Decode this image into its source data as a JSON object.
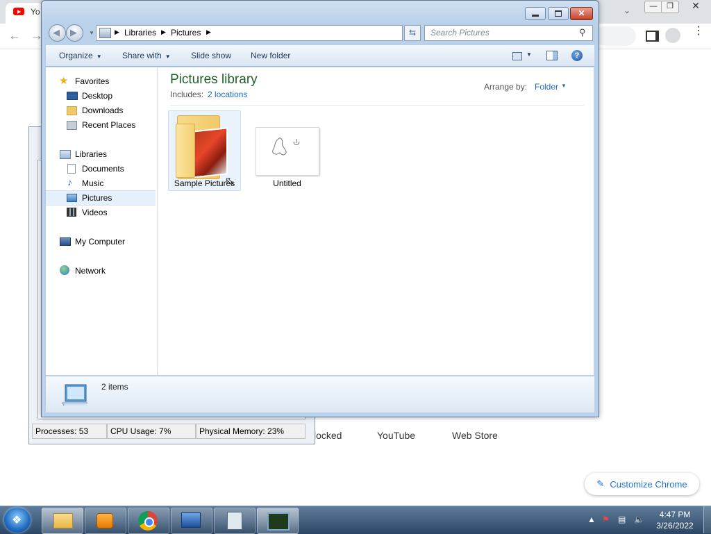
{
  "chrome": {
    "tab_title": "Yo",
    "shortcuts": [
      "locked",
      "YouTube",
      "Web Store"
    ],
    "customize_label": "Customize Chrome"
  },
  "task_manager": {
    "processes": "Processes: 53",
    "cpu": "CPU Usage: 7%",
    "memory": "Physical Memory: 23%"
  },
  "explorer": {
    "address": {
      "crumbs": [
        "Libraries",
        "Pictures"
      ]
    },
    "search": {
      "placeholder": "Search Pictures"
    },
    "commands": {
      "organize": "Organize",
      "share_with": "Share with",
      "slide_show": "Slide show",
      "new_folder": "New folder"
    },
    "nav": {
      "favorites": "Favorites",
      "desktop": "Desktop",
      "downloads": "Downloads",
      "recent_places": "Recent Places",
      "libraries": "Libraries",
      "documents": "Documents",
      "music": "Music",
      "pictures": "Pictures",
      "videos": "Videos",
      "my_computer": "My Computer",
      "network": "Network"
    },
    "content": {
      "title": "Pictures library",
      "includes_label": "Includes:",
      "includes_link": "2 locations",
      "arrange_label": "Arrange by:",
      "arrange_value": "Folder",
      "items": [
        {
          "name": "Sample Pictures"
        },
        {
          "name": "Untitled"
        }
      ]
    },
    "details": {
      "count": "2 items"
    }
  },
  "taskbar": {
    "time": "4:47 PM",
    "date": "3/26/2022"
  },
  "colors": {
    "accent_link": "#1f6cc0",
    "library_title": "#1e5f2b",
    "close_button": "#c4442b"
  }
}
